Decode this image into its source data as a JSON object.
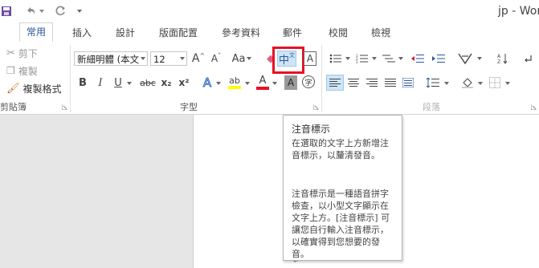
{
  "title": "jp - Wor",
  "quick_access": {
    "save_icon": "save-icon",
    "undo_icon": "undo-icon",
    "redo_icon": "redo-icon",
    "customize_icon": "chevron-down-icon"
  },
  "tabs": [
    {
      "label": "常用",
      "active": true
    },
    {
      "label": "插入"
    },
    {
      "label": "設計"
    },
    {
      "label": "版面配置"
    },
    {
      "label": "參考資料"
    },
    {
      "label": "郵件"
    },
    {
      "label": "校閱"
    },
    {
      "label": "檢視"
    }
  ],
  "clipboard": {
    "cut": "剪下",
    "copy": "複製",
    "format_painter": "複製格式",
    "group_label": "剪貼簿"
  },
  "font": {
    "font_name": "新細明體 (本文",
    "font_size": "12",
    "grow_label": "A",
    "shrink_label": "A",
    "change_case_label": "Aa",
    "phonetic_label": "中",
    "border_label": "A",
    "bold": "B",
    "italic": "I",
    "underline": "U",
    "strike": "abc",
    "subscript": "x₂",
    "superscript": "x²",
    "text_effect": "A",
    "highlight": "ab",
    "font_color": "A",
    "shading": "A",
    "enclose": "字",
    "group_label": "字型"
  },
  "paragraph": {
    "group_label": "段落"
  },
  "tooltip": {
    "title": "注音標示",
    "para1": "在選取的文字上方新增注音標示，以釐清發音。",
    "para2": "注音標示是一種語音拼字檢查，以小型文字顯示在文字上方。[注音標示] 可讓您自行輸入注音標示，以確實得到您想要的發音。"
  },
  "colors": {
    "accent": "#2b579a",
    "highlight_box": "#e81123",
    "highlight_yellow": "#ffff00",
    "font_red": "#e81123"
  }
}
